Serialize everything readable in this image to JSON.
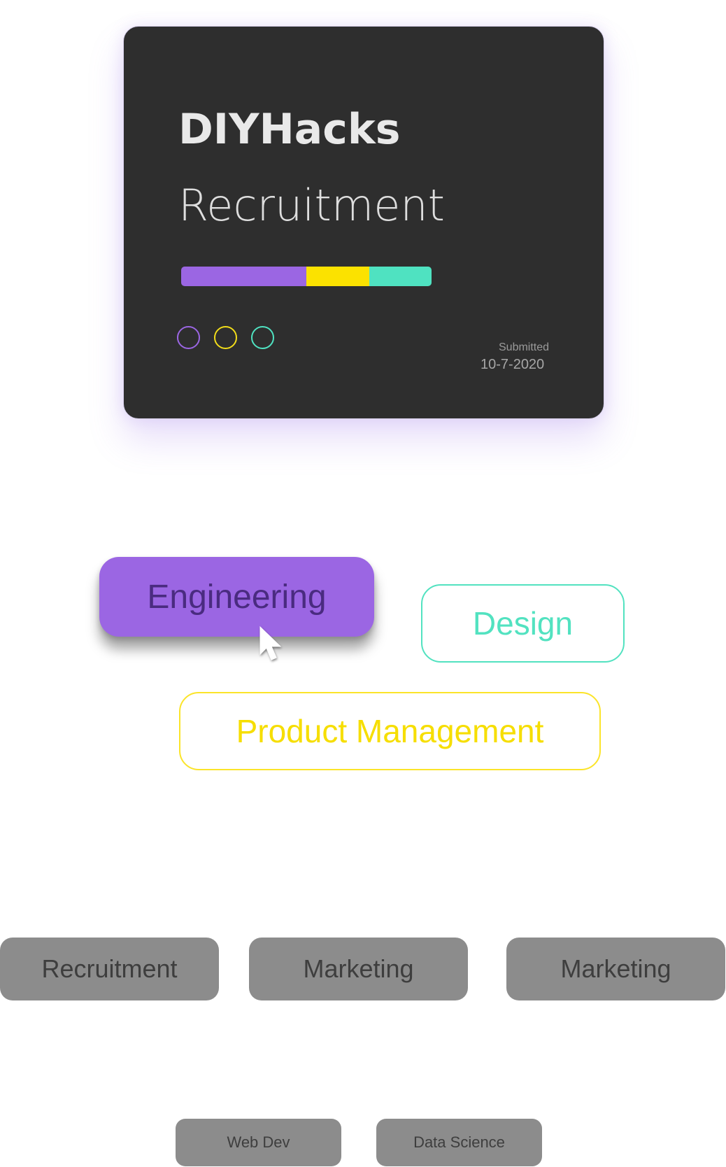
{
  "card": {
    "title": "DIYHacks",
    "subtitle": "Recruitment",
    "progress": [
      {
        "name": "purple",
        "fraction": 0.5,
        "color": "#9b66e3"
      },
      {
        "name": "yellow",
        "fraction": 0.25,
        "color": "#fbe200"
      },
      {
        "name": "teal",
        "fraction": 0.25,
        "color": "#4fe2c1"
      }
    ],
    "dots": [
      {
        "color": "#9b66e3"
      },
      {
        "color": "#f2dd1a"
      },
      {
        "color": "#4fe2c1"
      }
    ],
    "submitted_label": "Submitted",
    "submitted_date": "10-7-2020"
  },
  "categories": {
    "engineering": {
      "label": "Engineering",
      "color": "#9b66e3",
      "selected": true
    },
    "design": {
      "label": "Design",
      "color": "#52e2c0"
    },
    "product_management": {
      "label": "Product Management",
      "color": "#fbe42a"
    }
  },
  "tags_large": [
    {
      "label": "Recruitment"
    },
    {
      "label": "Marketing"
    },
    {
      "label": "Marketing"
    }
  ],
  "tags_small": [
    {
      "label": "Web Dev"
    },
    {
      "label": "Data Science"
    }
  ]
}
